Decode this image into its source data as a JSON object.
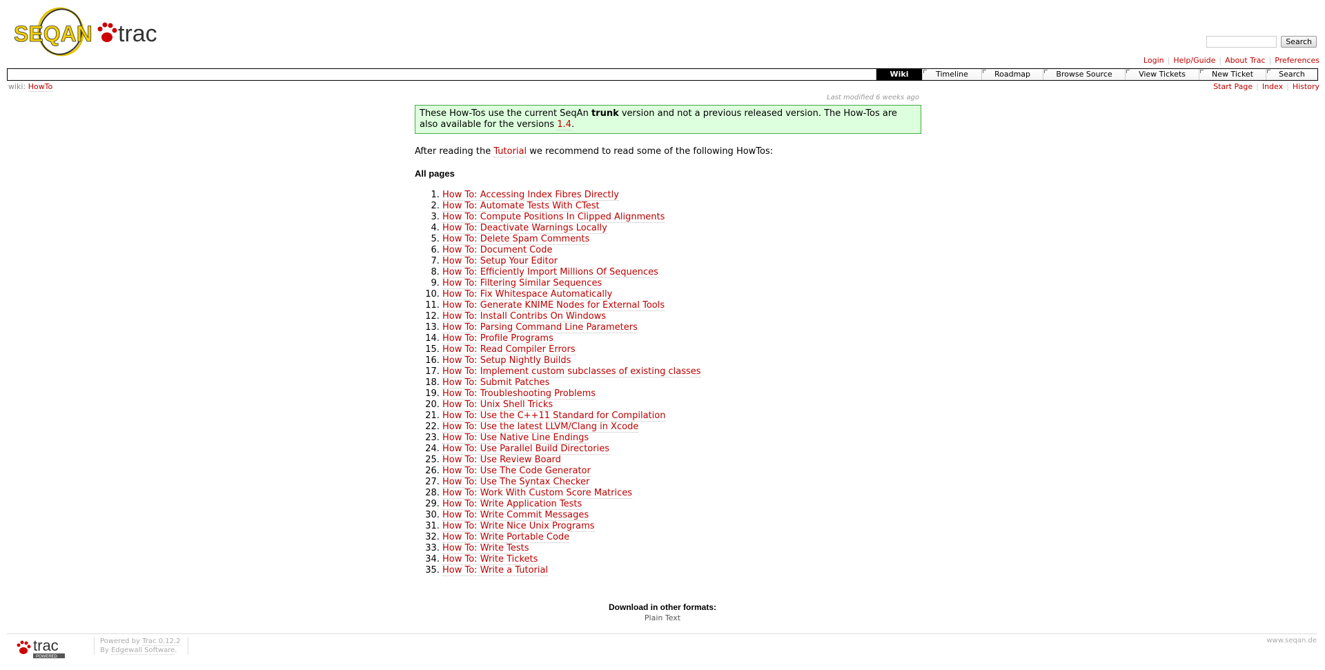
{
  "header": {
    "search_button": "Search"
  },
  "metanav": [
    "Login",
    "Help/Guide",
    "About Trac",
    "Preferences"
  ],
  "mainnav": [
    "Wiki",
    "Timeline",
    "Roadmap",
    "Browse Source",
    "View Tickets",
    "New Ticket",
    "Search"
  ],
  "breadcrumb": {
    "prefix": "wiki:",
    "page": "HowTo"
  },
  "ctxtnav": [
    "Start Page",
    "Index",
    "History"
  ],
  "last_modified": "Last modified 6 weeks ago",
  "notice": {
    "before": "These How-Tos use the current SeqAn ",
    "strong": "trunk",
    "middle": " version and not a previous released version. The How-Tos are also available for the versions ",
    "link": "1.4",
    "after": "."
  },
  "intro": {
    "before": "After reading the ",
    "link": "Tutorial",
    "after": " we recommend to read some of the following HowTos:"
  },
  "all_pages_heading": "All pages",
  "pages": [
    "How To: Accessing Index Fibres Directly",
    "How To: Automate Tests With CTest",
    "How To: Compute Positions In Clipped Alignments",
    "How To: Deactivate Warnings Locally",
    "How To: Delete Spam Comments",
    "How To: Document Code",
    "How To: Setup Your Editor",
    "How To: Efficiently Import Millions Of Sequences",
    "How To: Filtering Similar Sequences",
    "How To: Fix Whitespace Automatically",
    "How To: Generate KNIME Nodes for External Tools",
    "How To: Install Contribs On Windows",
    "How To: Parsing Command Line Parameters",
    "How To: Profile Programs",
    "How To: Read Compiler Errors",
    "How To: Setup Nightly Builds",
    "How To: Implement custom subclasses of existing classes",
    "How To: Submit Patches",
    "How To: Troubleshooting Problems",
    "How To: Unix Shell Tricks",
    "How To: Use the C++11 Standard for Compilation",
    "How To: Use the latest LLVM/Clang in Xcode",
    "How To: Use Native Line Endings",
    "How To: Use Parallel Build Directories",
    "How To: Use Review Board",
    "How To: Use The Code Generator",
    "How To: Use The Syntax Checker",
    "How To: Work With Custom Score Matrices",
    "How To: Write Application Tests",
    "How To: Write Commit Messages",
    "How To: Write Nice Unix Programs",
    "How To: Write Portable Code",
    "How To: Write Tests",
    "How To: Write Tickets",
    "How To: Write a Tutorial"
  ],
  "altlinks": {
    "heading": "Download in other formats:",
    "format": "Plain Text"
  },
  "footer": {
    "powered_by": "Powered by ",
    "trac_version": "Trac 0.12.2",
    "by": "By ",
    "edgewall": "Edgewall Software",
    "period": ".",
    "site": "www.seqan.de"
  },
  "colors": {
    "link": "#bb0000",
    "notice_bg": "#ddffdd",
    "notice_border": "#44aa44"
  }
}
